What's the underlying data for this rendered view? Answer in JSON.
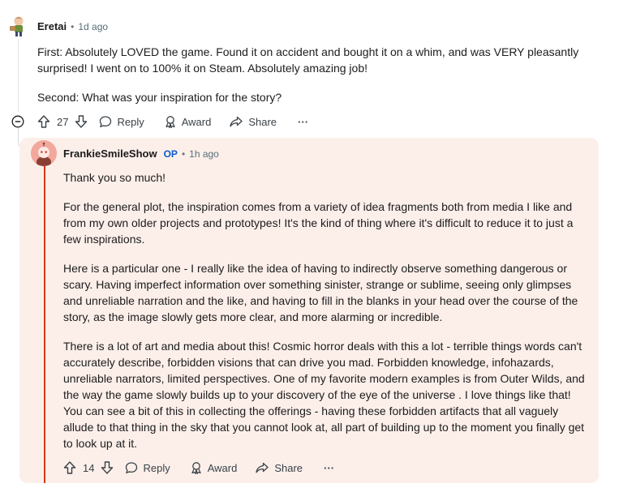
{
  "comment1": {
    "author": "Eretai",
    "separator": "•",
    "time": "1d ago",
    "paragraphs": [
      "First: Absolutely LOVED the game. Found it on accident and bought it on a whim, and was VERY pleasantly surprised! I went on to 100% it on Steam. Absolutely amazing job!",
      "Second: What was your inspiration for the story?"
    ],
    "votes": "27",
    "reply_label": "Reply",
    "award_label": "Award",
    "share_label": "Share",
    "more_label": "···"
  },
  "comment2": {
    "author": "FrankieSmileShow",
    "op_badge": "OP",
    "separator": "•",
    "time": "1h ago",
    "paragraphs": [
      "Thank you so much!",
      "For the general plot, the inspiration comes from a variety of idea fragments both from media I like and from my own older projects and prototypes! It's the kind of thing where it's difficult to reduce it to just a few inspirations.",
      "Here is a particular one - I really like the idea of having to indirectly observe something dangerous or scary. Having imperfect information over something sinister, strange or sublime, seeing only glimpses and unreliable narration and the like, and having to fill in the blanks in your head over the course of the story, as the image slowly gets more clear, and more alarming or incredible.",
      "There is a lot of art and media about this! Cosmic horror deals with this a lot - terrible things words can't accurately describe, forbidden visions that can drive you mad. Forbidden knowledge, infohazards, unreliable narrators, limited perspectives. One of my favorite modern examples is from Outer Wilds, and the way the game slowly builds up to your discovery of the eye of the universe . I love things like that! You can see a bit of this in collecting the offerings - having these forbidden artifacts that all vaguely allude to that thing in the sky that you cannot look at, all part of building up to the moment you finally get to look up at it."
    ],
    "votes": "14",
    "reply_label": "Reply",
    "award_label": "Award",
    "share_label": "Share",
    "more_label": "···"
  },
  "colors": {
    "highlight_bg": "#fcefea",
    "op_blue": "#0a5ad1",
    "thread_accent": "#d93a00"
  }
}
